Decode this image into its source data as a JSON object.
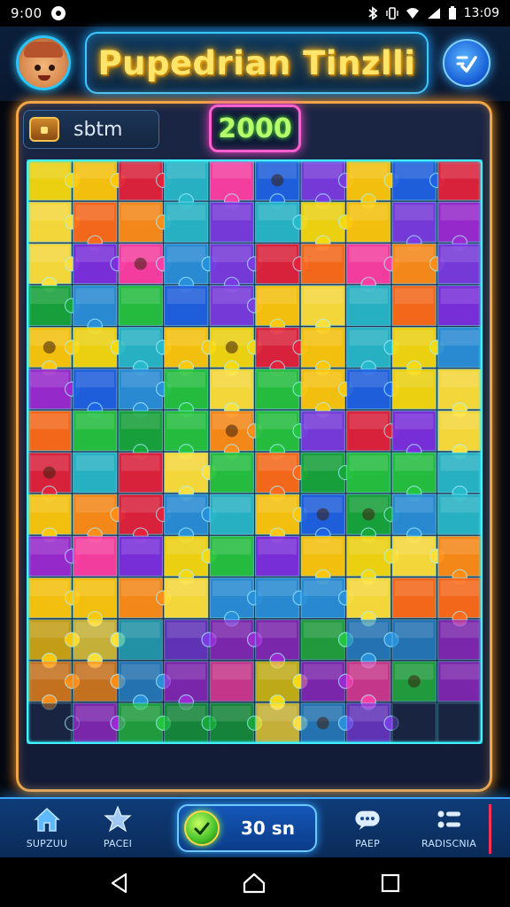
{
  "status_bar": {
    "time": "9:00",
    "clock": "13:09",
    "icons": [
      "bluetooth-icon",
      "vibrate-icon",
      "wifi-icon",
      "signal-icon",
      "battery-icon"
    ]
  },
  "header": {
    "title": "Pupedrian Tinzlli",
    "avatar_icon": "character-avatar",
    "menu_icon": "checkmark-menu-icon"
  },
  "stats": {
    "label": "sbtm",
    "icon": "chest-icon"
  },
  "score": {
    "value": "2000"
  },
  "puzzle": {
    "rows": 14,
    "cols": 10,
    "palette": [
      "#2a8fd9",
      "#7a3be0",
      "#1f62e3",
      "#ff8d17",
      "#7d2fe0",
      "#25c43f",
      "#ffc80c",
      "#f7d90f",
      "#e3223b",
      "#27b8c9",
      "#ff3fa4",
      "#ffe03a",
      "#16a63a",
      "#ff6b1a",
      "#9c2ad1"
    ]
  },
  "bottom_nav": {
    "items": [
      {
        "label": "SUPZUU",
        "icon": "home-icon"
      },
      {
        "label": "PACEI",
        "icon": "star-icon"
      },
      {
        "label": "PAEP",
        "icon": "chat-icon"
      },
      {
        "label": "RADISCNIA",
        "icon": "settings-list-icon"
      }
    ],
    "center_button": {
      "label": "30 sn",
      "icon": "coin-icon"
    }
  },
  "android_nav": {
    "icons": [
      "back-icon",
      "home-button-icon",
      "recents-icon"
    ]
  }
}
